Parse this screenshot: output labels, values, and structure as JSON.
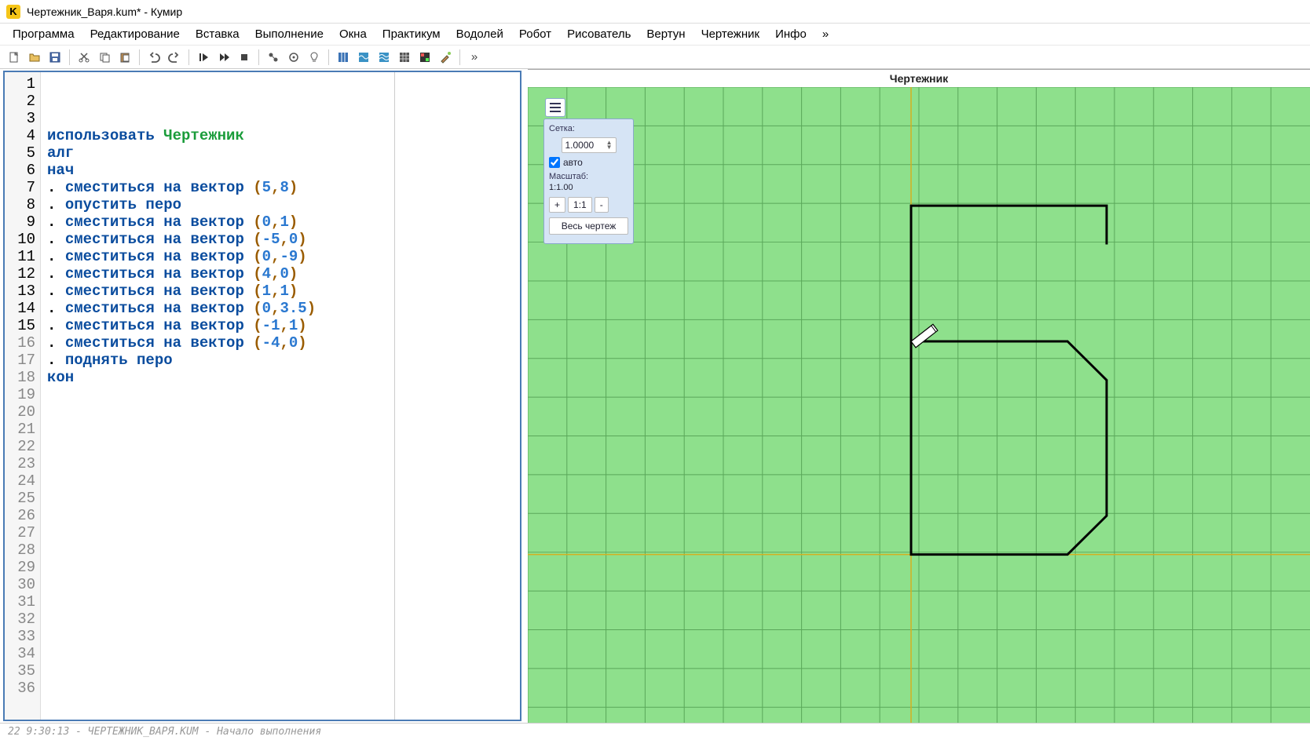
{
  "titlebar": {
    "app_icon_letter": "K",
    "title": "Чертежник_Варя.kum* - Кумир"
  },
  "menubar": {
    "items": [
      "Программа",
      "Редактирование",
      "Вставка",
      "Выполнение",
      "Окна",
      "Практикум",
      "Водолей",
      "Робот",
      "Рисователь",
      "Вертун",
      "Чертежник",
      "Инфо",
      "»"
    ]
  },
  "toolbar": {
    "overflow": "»"
  },
  "editor": {
    "line_count": 36,
    "active_lines_max": 15,
    "lines": [
      {
        "kw": "использовать",
        "module": " Чертежник"
      },
      {
        "kw": "алг"
      },
      {
        "kw": "нач"
      },
      {
        "dot": ". ",
        "kw": "сместиться на вектор",
        "args": [
          "5",
          "8"
        ]
      },
      {
        "dot": ". ",
        "kw": "опустить перо"
      },
      {
        "dot": ". ",
        "kw": "сместиться на вектор",
        "args": [
          "0",
          "1"
        ]
      },
      {
        "dot": ". ",
        "kw": "сместиться на вектор",
        "args": [
          "-5",
          "0"
        ]
      },
      {
        "dot": ". ",
        "kw": "сместиться на вектор",
        "args": [
          "0",
          "-9"
        ]
      },
      {
        "dot": ". ",
        "kw": "сместиться на вектор",
        "args": [
          "4",
          "0"
        ]
      },
      {
        "dot": ". ",
        "kw": "сместиться на вектор",
        "args": [
          "1",
          "1"
        ]
      },
      {
        "dot": ". ",
        "kw": "сместиться на вектор",
        "args": [
          "0",
          "3.5"
        ]
      },
      {
        "dot": ". ",
        "kw": "сместиться на вектор",
        "args": [
          "-1",
          "1"
        ]
      },
      {
        "dot": ". ",
        "kw": "сместиться на вектор",
        "args": [
          "-4",
          "0"
        ]
      },
      {
        "dot": ". ",
        "kw": "поднять перо"
      },
      {
        "kw": "кон"
      }
    ]
  },
  "canvas": {
    "title": "Чертежник",
    "panel": {
      "grid_label": "Сетка:",
      "grid_value": "1.0000",
      "auto_label": "авто",
      "auto_checked": true,
      "scale_label": "Масштаб:",
      "scale_text": "1:1.00",
      "zoom_in": "+",
      "zoom_reset": "1:1",
      "zoom_out": "-",
      "fit_label": "Весь чертеж"
    }
  },
  "statusbar": {
    "text": "22  9:30:13 - ЧЕРТЕЖНИК_ВАРЯ.KUM - Начало выполнения"
  }
}
